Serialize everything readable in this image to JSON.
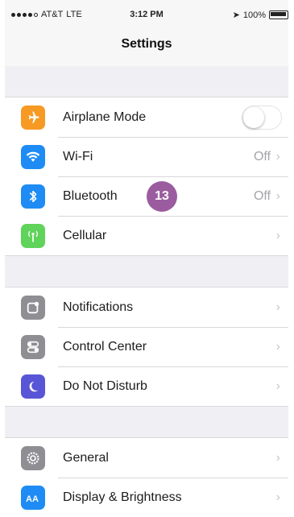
{
  "status_bar": {
    "carrier": "AT&T",
    "network": "LTE",
    "time": "3:12 PM",
    "location_glyph": "➤",
    "battery_percent": "100%"
  },
  "nav": {
    "title": "Settings"
  },
  "badge": {
    "text": "13",
    "color": "#9b5c9f"
  },
  "chevron": "›",
  "groups": [
    {
      "items": [
        {
          "label": "Airplane Mode",
          "icon": "airplane-icon",
          "icon_color": "#f79a24",
          "control": "toggle",
          "toggle_on": false
        },
        {
          "label": "Wi-Fi",
          "icon": "wifi-icon",
          "icon_color": "#1e8cf4",
          "value": "Off"
        },
        {
          "label": "Bluetooth",
          "icon": "bluetooth-icon",
          "icon_color": "#1e8cf4",
          "value": "Off"
        },
        {
          "label": "Cellular",
          "icon": "cellular-icon",
          "icon_color": "#5fd35a"
        }
      ]
    },
    {
      "items": [
        {
          "label": "Notifications",
          "icon": "notifications-icon",
          "icon_color": "#8e8e93"
        },
        {
          "label": "Control Center",
          "icon": "control-center-icon",
          "icon_color": "#8e8e93"
        },
        {
          "label": "Do Not Disturb",
          "icon": "moon-icon",
          "icon_color": "#5856d6"
        }
      ]
    },
    {
      "items": [
        {
          "label": "General",
          "icon": "gear-icon",
          "icon_color": "#8e8e93"
        },
        {
          "label": "Display & Brightness",
          "icon": "display-brightness-icon",
          "icon_color": "#1e8cf4"
        }
      ]
    }
  ]
}
